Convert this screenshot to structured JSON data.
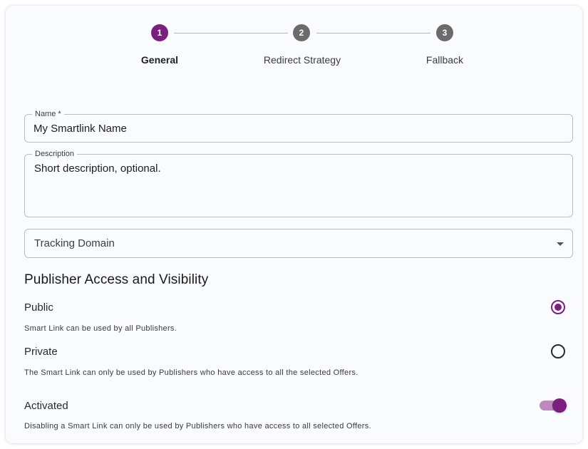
{
  "stepper": {
    "steps": [
      {
        "number": "1",
        "label": "General",
        "state": "active"
      },
      {
        "number": "2",
        "label": "Redirect Strategy",
        "state": "inactive"
      },
      {
        "number": "3",
        "label": "Fallback",
        "state": "inactive"
      }
    ]
  },
  "form": {
    "name": {
      "label": "Name *",
      "value": "My Smartlink Name"
    },
    "description": {
      "label": "Description",
      "value": "Short description, optional."
    },
    "tracking_domain": {
      "placeholder": "Tracking Domain"
    }
  },
  "access": {
    "title": "Publisher Access and Visibility",
    "options": [
      {
        "label": "Public",
        "help": "Smart Link can be used by all Publishers.",
        "selected": true
      },
      {
        "label": "Private",
        "help": "The Smart Link can only be used by Publishers who have access to all the selected Offers.",
        "selected": false
      }
    ],
    "activated": {
      "label": "Activated",
      "help": "Disabling a Smart Link can only be used by Publishers who have access to all selected Offers.",
      "on": true
    }
  },
  "colors": {
    "accent": "#7b1f7e",
    "inactive_step": "#6b6b6b",
    "switch_track": "#bf88bf"
  }
}
